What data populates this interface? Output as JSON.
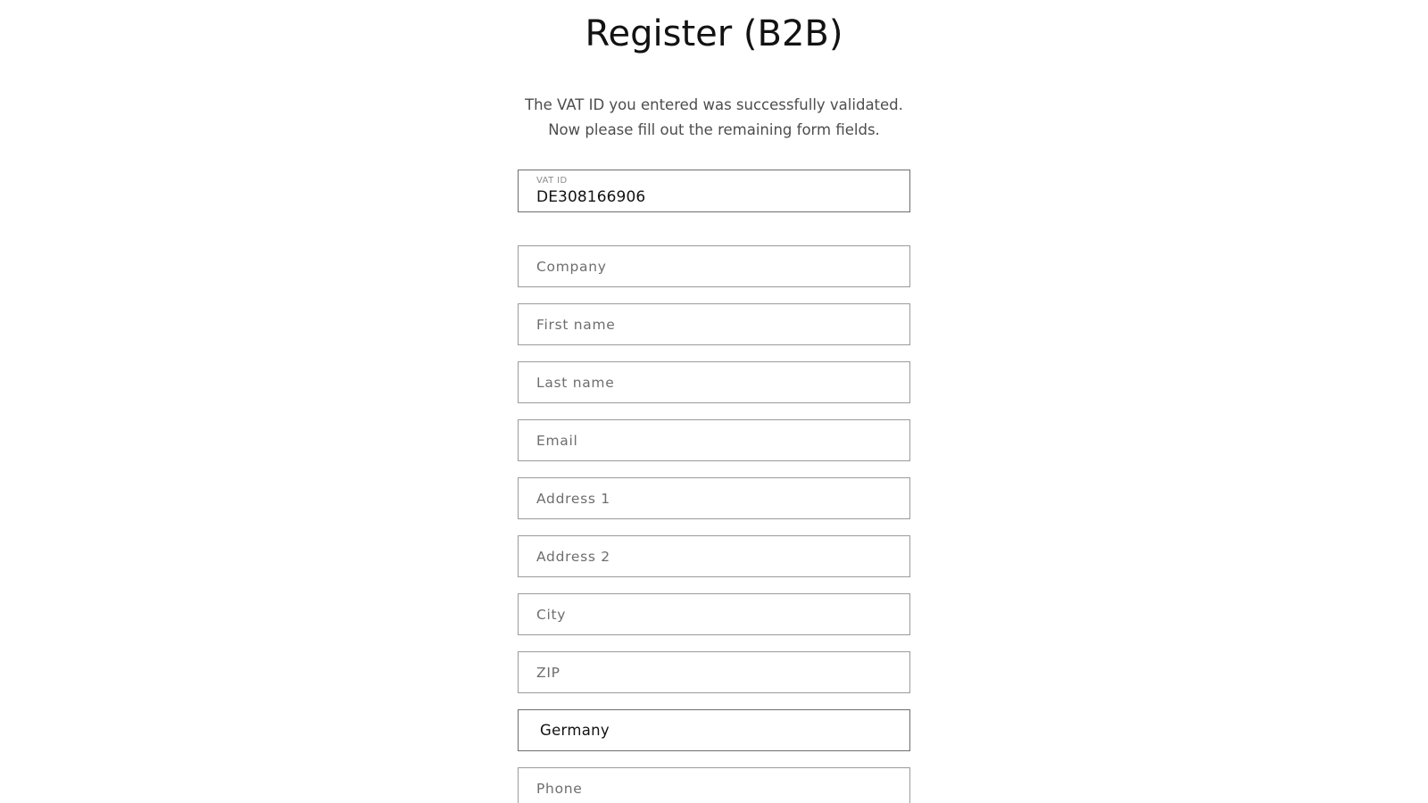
{
  "page": {
    "title": "Register (B2B)",
    "intro": "The VAT ID you entered was successfully validated. Now please fill out the remaining form fields."
  },
  "form": {
    "vat_id": {
      "label": "VAT ID",
      "value": "DE308166906"
    },
    "fields": [
      {
        "name": "company",
        "placeholder": "Company",
        "value": ""
      },
      {
        "name": "first_name",
        "placeholder": "First name",
        "value": ""
      },
      {
        "name": "last_name",
        "placeholder": "Last name",
        "value": ""
      },
      {
        "name": "email",
        "placeholder": "Email",
        "value": ""
      },
      {
        "name": "address_1",
        "placeholder": "Address 1",
        "value": ""
      },
      {
        "name": "address_2",
        "placeholder": "Address 2",
        "value": ""
      },
      {
        "name": "city",
        "placeholder": "City",
        "value": ""
      },
      {
        "name": "zip",
        "placeholder": "ZIP",
        "value": ""
      }
    ],
    "country": {
      "name": "country",
      "selected": "Germany"
    },
    "phone": {
      "name": "phone",
      "placeholder": "Phone",
      "value": ""
    }
  },
  "colors": {
    "text": "#121212",
    "muted": "#4d4d4d",
    "placeholder": "#6e6e6e",
    "border": "#9b9b9b",
    "border_active": "#6e6e6e",
    "background": "#ffffff"
  }
}
